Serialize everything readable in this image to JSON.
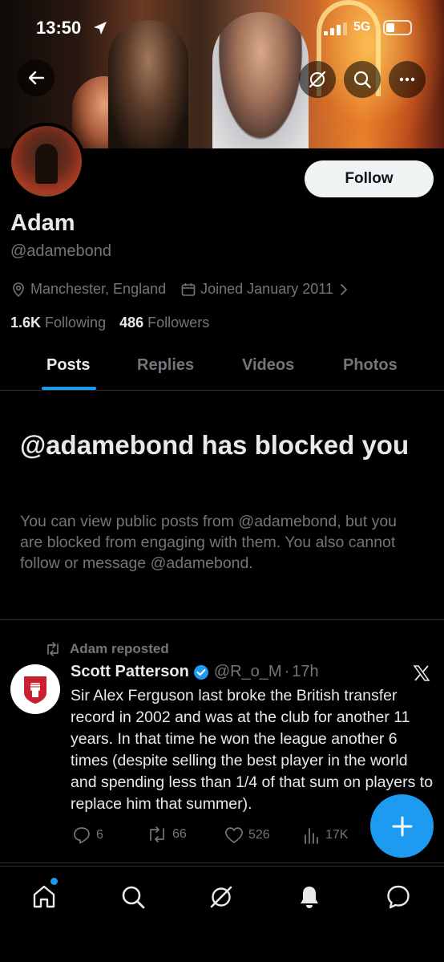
{
  "status_bar": {
    "time": "13:50",
    "network": "5G"
  },
  "profile": {
    "name": "Adam",
    "handle": "@adamebond",
    "location": "Manchester, England",
    "joined": "Joined January 2011",
    "following_count": "1.6K",
    "following_label": "Following",
    "followers_count": "486",
    "followers_label": "Followers",
    "follow_button": "Follow"
  },
  "tabs": [
    {
      "label": "Posts",
      "active": true
    },
    {
      "label": "Replies",
      "active": false
    },
    {
      "label": "Videos",
      "active": false
    },
    {
      "label": "Photos",
      "active": false
    }
  ],
  "blocked": {
    "title": "@adamebond has blocked you",
    "description": "You can view public posts from @adamebond, but you are blocked from engaging with them. You also cannot follow or message @adamebond."
  },
  "post": {
    "repost_label": "Adam reposted",
    "author": "Scott Patterson",
    "handle": "@R_o_M",
    "separator": "·",
    "time": "17h",
    "text": "Sir Alex Ferguson last broke the British transfer record in 2002 and was at the club for another 11 years. In that time he won the league another 6 times (despite selling the best player in the world and spending less than 1/4 of that sum on players to replace him that summer).",
    "replies": "6",
    "reposts": "66",
    "likes": "526",
    "views": "17K"
  },
  "colors": {
    "accent": "#1d9bf0",
    "muted": "#71767b",
    "text": "#e7e9ea",
    "background": "#000000"
  }
}
